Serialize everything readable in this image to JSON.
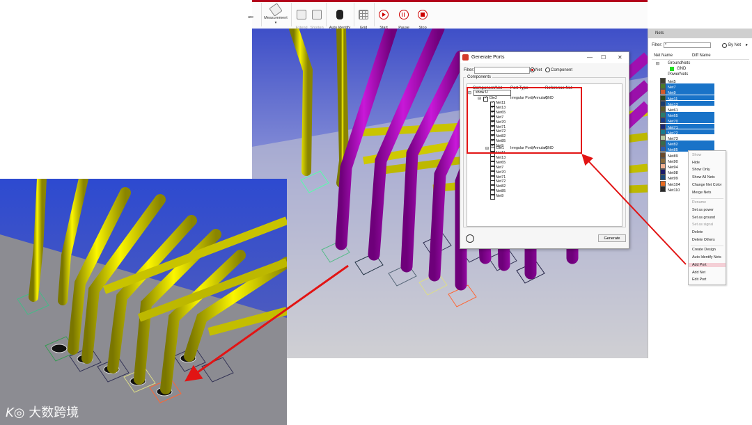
{
  "toolbar": {
    "partial_label": "ure",
    "buttons": [
      {
        "label": "Measurement",
        "sub": "▾",
        "icon": "ruler-icon",
        "enabled": true
      },
      {
        "label": "Extend\nTrace",
        "icon": "extend-trace-icon",
        "enabled": false
      },
      {
        "label": "Shorten\nTrace",
        "icon": "shorten-trace-icon",
        "enabled": false
      },
      {
        "label": "Auto Identify\nNets",
        "icon": "auto-identify-icon",
        "enabled": true
      },
      {
        "label": "Grid\nSetting",
        "icon": "grid-icon",
        "enabled": true
      },
      {
        "label": "Start\nRecord",
        "icon": "record-start-icon",
        "enabled": true
      },
      {
        "label": "Pause\nRecord",
        "icon": "record-pause-icon",
        "enabled": true
      },
      {
        "label": "Stop\nRecord",
        "icon": "record-stop-icon",
        "enabled": true
      }
    ]
  },
  "nets_panel": {
    "title": "Nets",
    "filter_label": "Filter:",
    "filter_value": "*",
    "by_net_label": "By Net",
    "col_net_name": "Net Name",
    "col_diff_name": "Diff Name",
    "ground_group": "GroundNets",
    "gnd": "GND",
    "power_group": "PowerNets",
    "nets": [
      {
        "name": "Net5",
        "color": "#3d3d2f",
        "selected": false
      },
      {
        "name": "Net7",
        "color": "#4c7a2a",
        "selected": true
      },
      {
        "name": "Net9",
        "color": "#d15a2c",
        "selected": true
      },
      {
        "name": "Net11",
        "color": "#2b4a1d",
        "selected": true
      },
      {
        "name": "Net13",
        "color": "#1a3a6b",
        "selected": true
      },
      {
        "name": "Net61",
        "color": "#5a5a2b",
        "selected": false
      },
      {
        "name": "Net65",
        "color": "#2b7b6b",
        "selected": true
      },
      {
        "name": "Net70",
        "color": "#1e3c8a",
        "selected": true
      },
      {
        "name": "Net71",
        "color": "#1a2a7a",
        "selected": true
      },
      {
        "name": "Net72",
        "color": "#1a7a8a",
        "selected": true
      },
      {
        "name": "Net73",
        "color": "#b8c9a0",
        "selected": false
      },
      {
        "name": "Net82",
        "color": "#3a6a4a",
        "selected": true
      },
      {
        "name": "Net85",
        "color": "#2a5aaa",
        "selected": true
      },
      {
        "name": "Net89",
        "color": "#6a4a2a",
        "selected": false
      },
      {
        "name": "Net90",
        "color": "#8a6a3a",
        "selected": false
      },
      {
        "name": "Net94",
        "color": "#f0b090",
        "selected": false
      },
      {
        "name": "Net98",
        "color": "#1a1a6a",
        "selected": false
      },
      {
        "name": "Net99",
        "color": "#1a4a7a",
        "selected": false
      },
      {
        "name": "Net104",
        "color": "#e86a20",
        "selected": false
      },
      {
        "name": "Net110",
        "color": "#2a2a2a",
        "selected": false
      }
    ]
  },
  "context_menu": {
    "items": [
      {
        "label": "Show",
        "enabled": false
      },
      {
        "label": "Hide",
        "enabled": true
      },
      {
        "label": "Show Only",
        "enabled": true
      },
      {
        "label": "Show All Nets",
        "enabled": true
      },
      {
        "label": "Change Net Color",
        "enabled": true
      },
      {
        "label": "Merge Nets",
        "enabled": true
      },
      {
        "label": "Rename",
        "enabled": false
      },
      {
        "label": "Set as power",
        "enabled": true
      },
      {
        "label": "Set as ground",
        "enabled": true
      },
      {
        "label": "Set as signal",
        "enabled": false
      },
      {
        "label": "Delete",
        "enabled": true
      },
      {
        "label": "Delete Others",
        "enabled": true
      },
      {
        "label": "Create Design",
        "enabled": true
      },
      {
        "label": "Auto Identify Nets",
        "enabled": true
      },
      {
        "label": "Add Port",
        "enabled": true,
        "highlight": true
      },
      {
        "label": "Add Net",
        "enabled": true
      },
      {
        "label": "Edit Port",
        "enabled": true
      }
    ]
  },
  "dialog": {
    "title": "Generate Ports",
    "filter_label": "Filter:",
    "radio_net": "Net",
    "radio_component": "Component",
    "components_label": "Components",
    "col_component_net": "Component/Net",
    "col_port_type": "Port Type",
    "col_reference_net": "Reference Net",
    "root": "show U",
    "comp1": "Die2",
    "comp1_port_type": "Irregular Port(Annular)",
    "comp1_ref": "GND",
    "comp2": "Die1",
    "comp2_port_type": "Irregular Port(Annular)",
    "comp2_ref": "GND",
    "nets": [
      "Net11",
      "Net13",
      "Net65",
      "Net7",
      "Net70",
      "Net71",
      "Net72",
      "Net82",
      "Net85",
      "Net9"
    ],
    "generate_label": "Generate"
  },
  "watermark": "大数跨境"
}
